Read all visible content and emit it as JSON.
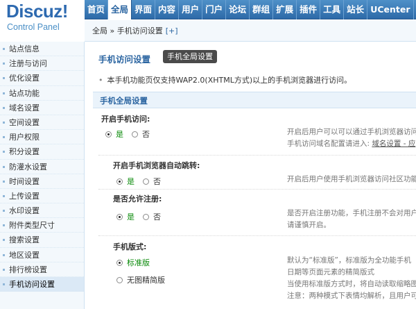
{
  "logo": {
    "title": "Discuz!",
    "subtitle": "Control Panel"
  },
  "topnav": [
    "首页",
    "全局",
    "界面",
    "内容",
    "用户",
    "门户",
    "论坛",
    "群组",
    "扩展",
    "插件",
    "工具",
    "站长",
    "UCenter"
  ],
  "breadcrumb": {
    "text": "全局 » 手机访问设置",
    "plus": "[+]"
  },
  "sidebar": [
    "站点信息",
    "注册与访问",
    "优化设置",
    "站点功能",
    "域名设置",
    "空间设置",
    "用户权限",
    "积分设置",
    "防灌水设置",
    "时间设置",
    "上传设置",
    "水印设置",
    "附件类型尺寸",
    "搜索设置",
    "地区设置",
    "排行榜设置",
    "手机访问设置"
  ],
  "page": {
    "title": "手机访问设置",
    "tab": "手机全局设置",
    "tip": "本手机功能页仅支持WAP2.0(XHTML方式)以上的手机浏览器进行访问。",
    "section": "手机全局设置"
  },
  "settings": {
    "enable": {
      "label": "开启手机访问:",
      "yes": "是",
      "no": "否",
      "desc1": "开启后用户可以可以通过手机浏览器访问",
      "desc2_prefix": "手机访问域名配置请进入: ",
      "desc2_link": "域名设置 - 应"
    },
    "autojump": {
      "label": "开启手机浏览器自动跳转:",
      "yes": "是",
      "no": "否",
      "desc1": "开启后用户使用手机浏览器访问社区功能"
    },
    "register": {
      "label": "是否允许注册:",
      "yes": "是",
      "no": "否",
      "desc1": "是否开启注册功能，手机注册不会对用户",
      "desc2": "请谨慎开启。"
    },
    "version": {
      "label": "手机版式:",
      "opt1": "标准版",
      "opt2": "无图精简版",
      "desc1": "默认为“标准版”，标准版为全功能手机",
      "desc2": "日期等页面元素的精简版式",
      "desc3": "当使用标准版方式时，将自动读取缩略图",
      "desc4": "注意：两种模式下表情均解析，且用户可"
    }
  }
}
